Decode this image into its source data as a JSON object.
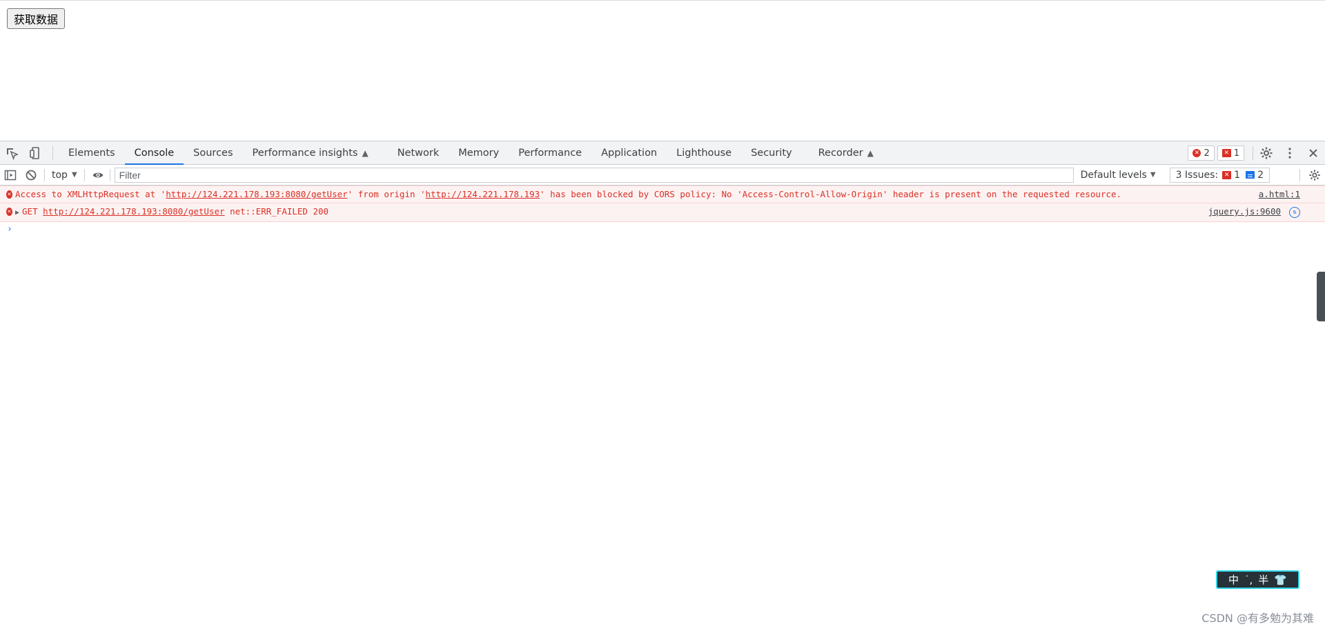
{
  "page": {
    "fetch_button_label": "获取数据"
  },
  "devtools": {
    "tabs": [
      {
        "label": "Elements",
        "flask": false
      },
      {
        "label": "Console",
        "flask": false,
        "active": true
      },
      {
        "label": "Sources",
        "flask": false
      },
      {
        "label": "Performance insights",
        "flask": true
      },
      {
        "label": "Network",
        "flask": false
      },
      {
        "label": "Memory",
        "flask": false
      },
      {
        "label": "Performance",
        "flask": false
      },
      {
        "label": "Application",
        "flask": false
      },
      {
        "label": "Lighthouse",
        "flask": false
      },
      {
        "label": "Security",
        "flask": false
      },
      {
        "label": "Recorder",
        "flask": true
      }
    ],
    "error_count": "2",
    "issue_count": "1",
    "icons": {
      "inspect": "inspect-element-icon",
      "device": "device-toolbar-icon",
      "settings": "gear-icon",
      "more": "more-vertical-icon",
      "close": "close-icon",
      "flask": "experiment-flask-icon"
    }
  },
  "console_toolbar": {
    "context": "top",
    "filter_placeholder": "Filter",
    "levels_label": "Default levels",
    "issues_label": "3 Issues:",
    "issues_errors": "1",
    "issues_info": "2"
  },
  "console": {
    "cors_error": {
      "p1": "Access to XMLHttpRequest at '",
      "url1": "http://124.221.178.193:8080/getUser",
      "p2": "' from origin '",
      "url2": "http://124.221.178.193",
      "p3": "' has been blocked by CORS policy: No 'Access-Control-Allow-Origin' header is present on the requested resource.",
      "source": "a.html:1"
    },
    "get_error": {
      "method": "GET ",
      "url": "http://124.221.178.193:8080/getUser",
      "status": " net::ERR_FAILED 200",
      "source": "jquery.js:9600"
    },
    "prompt": "›"
  },
  "ime": {
    "chars": [
      "中",
      "˙,",
      "半"
    ]
  },
  "watermark": "CSDN @有多勉为其难",
  "colors": {
    "accent": "#1a73e8",
    "error": "#d93025",
    "error_bg": "#fdf2f2"
  }
}
